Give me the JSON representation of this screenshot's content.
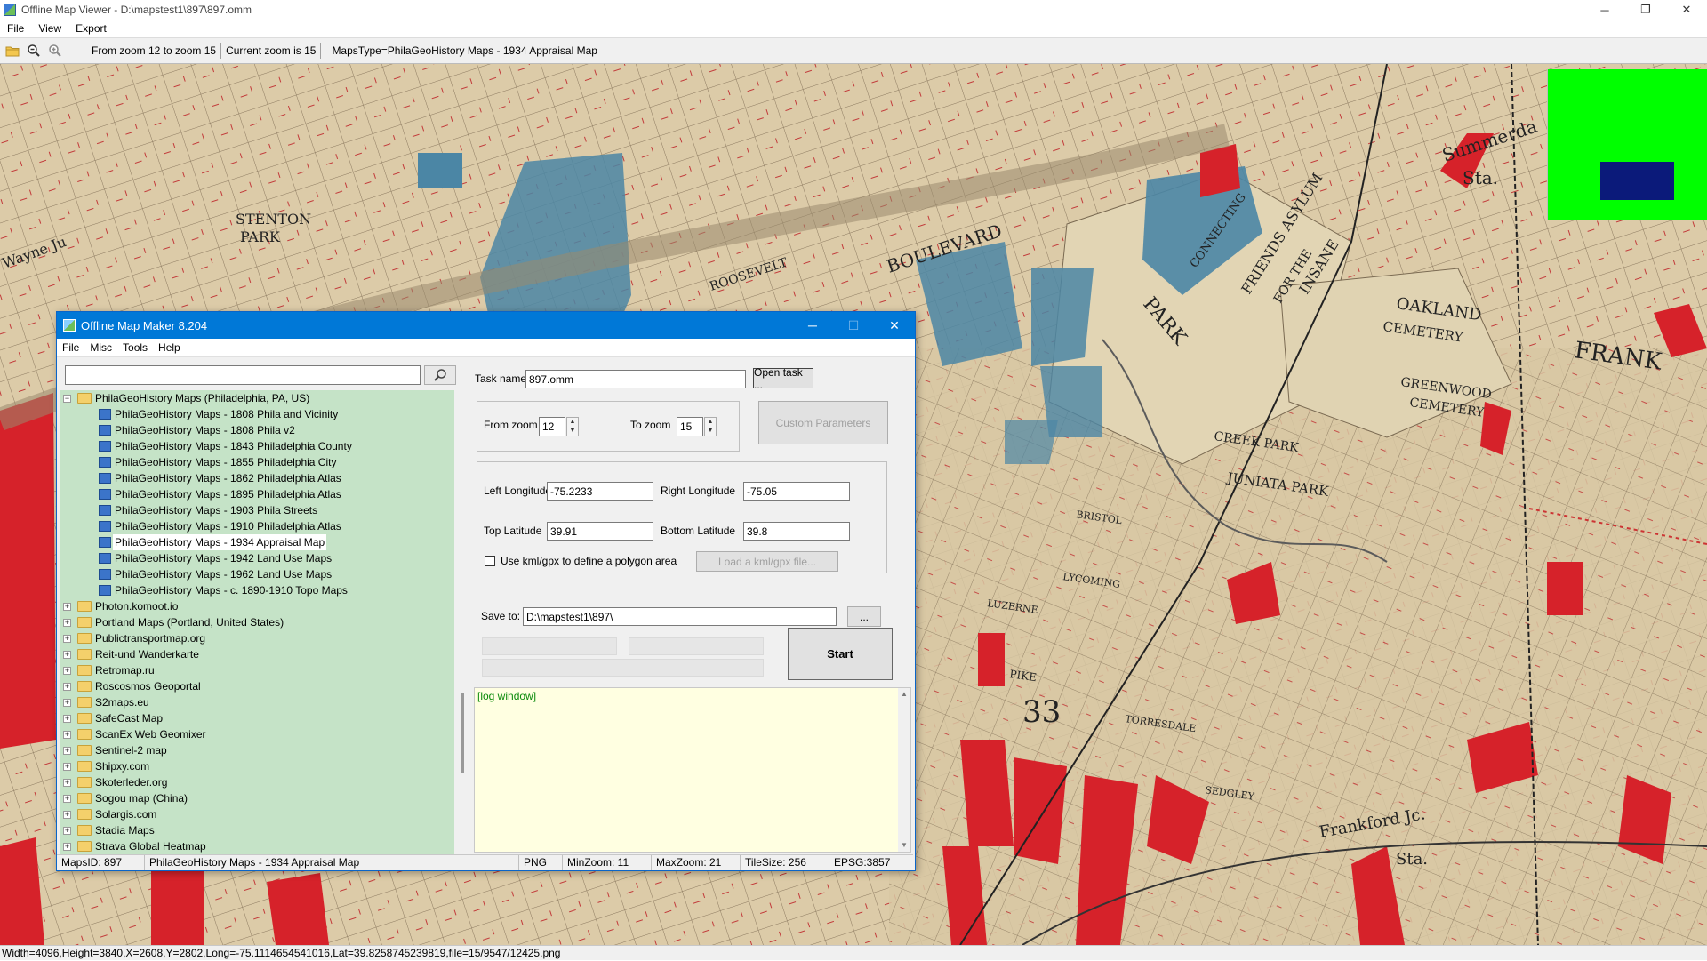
{
  "app": {
    "title": "Offline Map Viewer - D:\\mapstest1\\897\\897.omm",
    "menu": [
      "File",
      "View",
      "Export"
    ],
    "toolbar": {
      "zoom_range": "From zoom 12 to zoom 15",
      "current_zoom": "Current zoom is 15",
      "maps_type": "MapsType=PhilaGeoHistory Maps - 1934 Appraisal Map"
    },
    "status": "Width=4096,Height=3840,X=2608,Y=2802,Long=-75.1114654541016,Lat=39.8258745239819,file=15/9547/12425.png",
    "window_buttons": {
      "minimize": "─",
      "restore": "❐",
      "close": "✕"
    }
  },
  "map": {
    "labels": [
      "BOULEVARD",
      "PARK",
      "FRIENDS ASYLUM",
      "FOR THE",
      "INSANE",
      "OAKLAND",
      "CEMETERY",
      "GREENWOOD",
      "CEMETERY",
      "CREEK PARK",
      "JUNIATA PARK",
      "STENTON",
      "PARK",
      "FRANK",
      "LYCOMING",
      "LUZERNE",
      "BRISTOL",
      "PIKE",
      "SEDGLEY",
      "Frankford Jc.",
      "Sta.",
      "ROOSEVELT",
      "CONNECTING",
      "Summerda",
      "Sta.",
      "TORRESDALE",
      "33",
      "Wayne Ju"
    ]
  },
  "dialog": {
    "title": "Offline Map Maker 8.204",
    "menu": [
      "File",
      "Misc",
      "Tools",
      "Help"
    ],
    "search_placeholder": "",
    "tree": {
      "root": "PhilaGeoHistory Maps (Philadelphia, PA, US)",
      "children": [
        "PhilaGeoHistory Maps - 1808 Phila and Vicinity",
        "PhilaGeoHistory Maps - 1808 Phila v2",
        "PhilaGeoHistory Maps - 1843 Philadelphia County",
        "PhilaGeoHistory Maps - 1855 Philadelphia City",
        "PhilaGeoHistory Maps - 1862 Philadelphia Atlas",
        "PhilaGeoHistory Maps - 1895 Philadelphia Atlas",
        "PhilaGeoHistory Maps - 1903 Phila Streets",
        "PhilaGeoHistory Maps - 1910 Philadelphia Atlas",
        "PhilaGeoHistory Maps - 1934 Appraisal Map",
        "PhilaGeoHistory Maps - 1942 Land Use Maps",
        "PhilaGeoHistory Maps - 1962 Land Use Maps",
        "PhilaGeoHistory Maps - c. 1890-1910 Topo Maps"
      ],
      "selected_index": 8,
      "folders": [
        "Photon.komoot.io",
        "Portland Maps (Portland, United States)",
        "Publictransportmap.org",
        "Reit-und Wanderkarte",
        "Retromap.ru",
        "Roscosmos Geoportal",
        "S2maps.eu",
        "SafeCast Map",
        "ScanEx Web Geomixer",
        "Sentinel-2 map",
        "Shipxy.com",
        "Skoterleder.org",
        "Sogou map (China)",
        "Solargis.com",
        "Stadia Maps",
        "Strava Global Heatmap"
      ]
    },
    "task_name_label": "Task name",
    "task_name": "897.omm",
    "open_task": "Open task ...",
    "from_zoom_label": "From zoom",
    "from_zoom": "12",
    "to_zoom_label": "To zoom",
    "to_zoom": "15",
    "custom_params": "Custom Parameters",
    "left_lon_label": "Left Longitude",
    "left_lon": "-75.2233",
    "right_lon_label": "Right Longitude",
    "right_lon": "-75.05",
    "top_lat_label": "Top Latitude",
    "top_lat": "39.91",
    "bottom_lat_label": "Bottom Latitude",
    "bottom_lat": "39.8",
    "kml_check_label": "Use kml/gpx to define a polygon area",
    "load_kml": "Load a kml/gpx file...",
    "save_to_label": "Save to:",
    "save_to": "D:\\mapstest1\\897\\",
    "browse": "...",
    "start": "Start",
    "log": "[log window]",
    "status": {
      "maps_id": "MapsID: 897",
      "map_name": "PhilaGeoHistory Maps - 1934 Appraisal Map",
      "format": "PNG",
      "min_zoom": "MinZoom: 11",
      "max_zoom": "MaxZoom: 21",
      "tile_size": "TileSize: 256",
      "epsg": "EPSG:3857"
    }
  }
}
